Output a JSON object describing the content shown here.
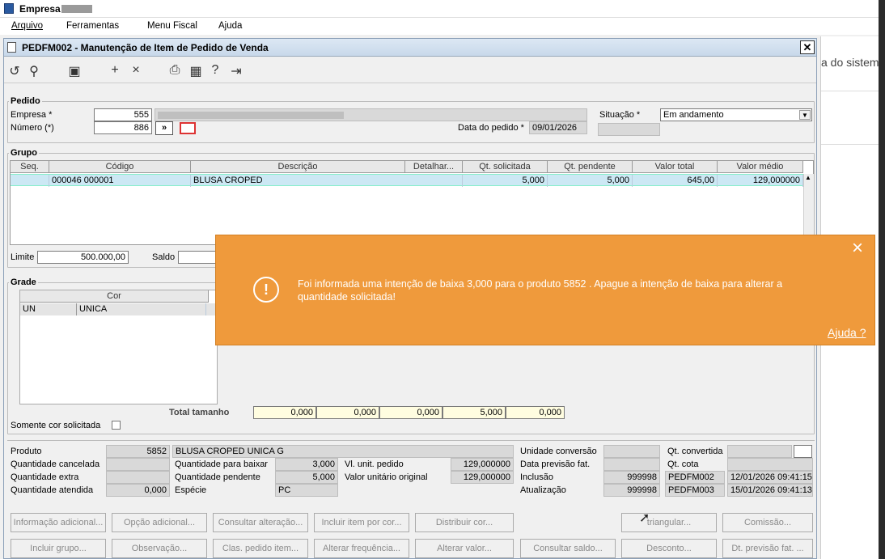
{
  "app": {
    "title": "Empresa"
  },
  "menu": {
    "items": [
      "Arquivo",
      "Ferramentas",
      "Menu Fiscal",
      "Ajuda"
    ]
  },
  "background": {
    "snippet": "a do sistem"
  },
  "window": {
    "title": "PEDFM002 - Manutenção de Item de Pedido de Venda"
  },
  "pedido": {
    "section": "Pedido",
    "empresa_label": "Empresa *",
    "empresa_value": "555",
    "numero_label": "Número (*)",
    "numero_value": "886",
    "data_label": "Data do pedido *",
    "data_value": "09/01/2026",
    "situacao_label": "Situação *",
    "situacao_value": "Em andamento",
    "nav_btn": "»"
  },
  "grupo": {
    "section": "Grupo",
    "columns": [
      "Seq.",
      "Código",
      "Descrição",
      "Detalhar...",
      "Qt. solicitada",
      "Qt. pendente",
      "Valor total",
      "Valor médio"
    ],
    "row": {
      "seq": "",
      "codigo": "000046 000001",
      "descricao": "BLUSA CROPED",
      "detalhar": "",
      "qt_solicitada": "5,000",
      "qt_pendente": "5,000",
      "valor_total": "645,00",
      "valor_medio": "129,000000"
    },
    "limite_label": "Limite",
    "limite_value": "500.000,00",
    "saldo_label": "Saldo"
  },
  "grade": {
    "section": "Grade",
    "col_cor": "Cor",
    "row_un": "UN",
    "row_cor": "UNICA",
    "total_label": "Total tamanho",
    "totals": [
      "0,000",
      "0,000",
      "0,000",
      "5,000",
      "0,000"
    ],
    "somente_label": "Somente cor solicitada"
  },
  "details": {
    "produto_label": "Produto",
    "produto_value": "5852",
    "produto_desc": "BLUSA CROPED UNICA G",
    "qtcanc_label": "Quantidade cancelada",
    "qtextra_label": "Quantidade extra",
    "qtatend_label": "Quantidade atendida",
    "qtatend_value": "0,000",
    "qtbaixar_label": "Quantidade para baixar",
    "qtbaixar_value": "3,000",
    "qtpend_label": "Quantidade pendente",
    "qtpend_value": "5,000",
    "especie_label": "Espécie",
    "especie_value": "PC",
    "vlunit_label": "Vl. unit. pedido",
    "vlunit_value": "129,000000",
    "vlorig_label": "Valor unitário original",
    "vlorig_value": "129,000000",
    "unconv_label": "Unidade conversão",
    "prevfat_label": "Data previsão fat.",
    "inclusao_label": "Inclusão",
    "inclusao_user": "999998",
    "inclusao_prog": "PEDFM002",
    "inclusao_date": "12/01/2026 09:41:15",
    "atualizacao_label": "Atualização",
    "atual_user": "999998",
    "atual_prog": "PEDFM003",
    "atual_date": "15/01/2026 09:41:13",
    "qtconv_label": "Qt. convertida",
    "qtcota_label": "Qt. cota"
  },
  "buttons": {
    "row1": [
      "Informação adicional...",
      "Opção adicional...",
      "Consultar alteração...",
      "Incluir item por cor...",
      "Distribuir cor...",
      "triangular...",
      "Comissão..."
    ],
    "row2": [
      "Incluir grupo...",
      "Observação...",
      "Clas. pedido item...",
      "Alterar frequência...",
      "Alterar valor...",
      "Consultar saldo...",
      "Desconto...",
      "Dt. previsão fat. ..."
    ]
  },
  "toast": {
    "message": "Foi informada uma intenção de baixa 3,000 para o produto 5852 . Apague a intenção de baixa para alterar a quantidade solicitada!",
    "help": "Ajuda ?",
    "close": "×",
    "icon": "!"
  },
  "colors": {
    "toast": "#ef9a3c",
    "selection": "#cce8f4"
  }
}
